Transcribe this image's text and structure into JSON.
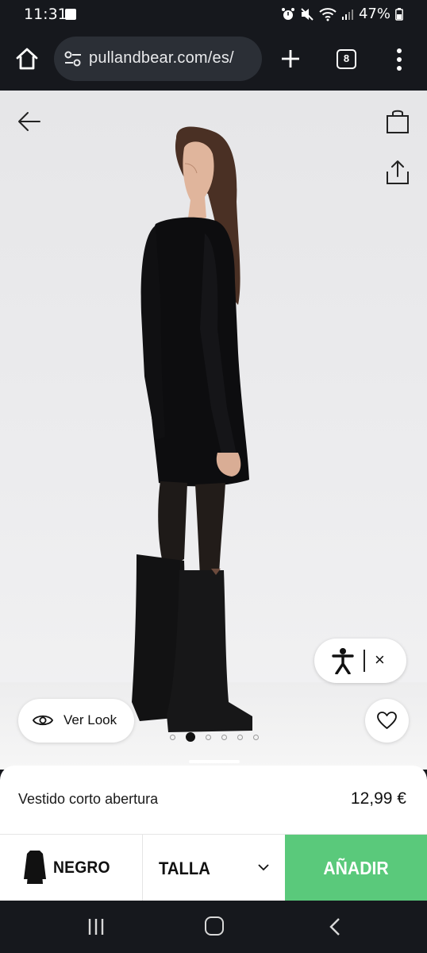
{
  "status": {
    "time": "11:31",
    "battery": "47%"
  },
  "browser": {
    "url": "pullandbear.com/es/",
    "tab_count": "8"
  },
  "gallery": {
    "ver_look_label": "Ver Look",
    "image_count": 6,
    "active_index": 1,
    "accessibility_close": "×"
  },
  "product": {
    "name": "Vestido corto abertura",
    "price": "12,99 €",
    "color_label": "NEGRO",
    "size_label": "TALLA",
    "add_label": "AÑADIR"
  },
  "colors": {
    "accent_green": "#5ac97b",
    "system_bar": "#16181d"
  }
}
